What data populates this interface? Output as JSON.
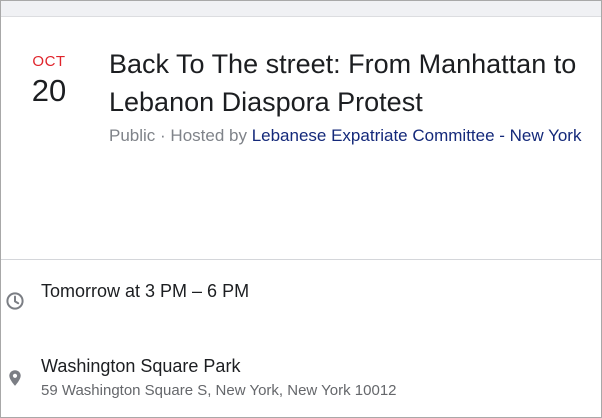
{
  "event": {
    "month": "OCT",
    "day": "20",
    "title": "Back To The street: From Manhattan to Lebanon Diaspora Protest",
    "privacy": "Public",
    "separator": " · ",
    "hosted_by_prefix": "Hosted by ",
    "host": "Lebanese Expatriate Committee - New York"
  },
  "details": {
    "time": {
      "icon": "clock-icon",
      "text": "Tomorrow at 3 PM – 6 PM"
    },
    "location": {
      "icon": "map-pin-icon",
      "name": "Washington Square Park",
      "address": "59 Washington Square S, New York, New York 10012"
    }
  },
  "colors": {
    "month_accent": "#e0242b",
    "link": "#14297a",
    "muted_text": "#7f8389",
    "primary_text": "#1c1e21",
    "icon": "#7b7e84"
  }
}
